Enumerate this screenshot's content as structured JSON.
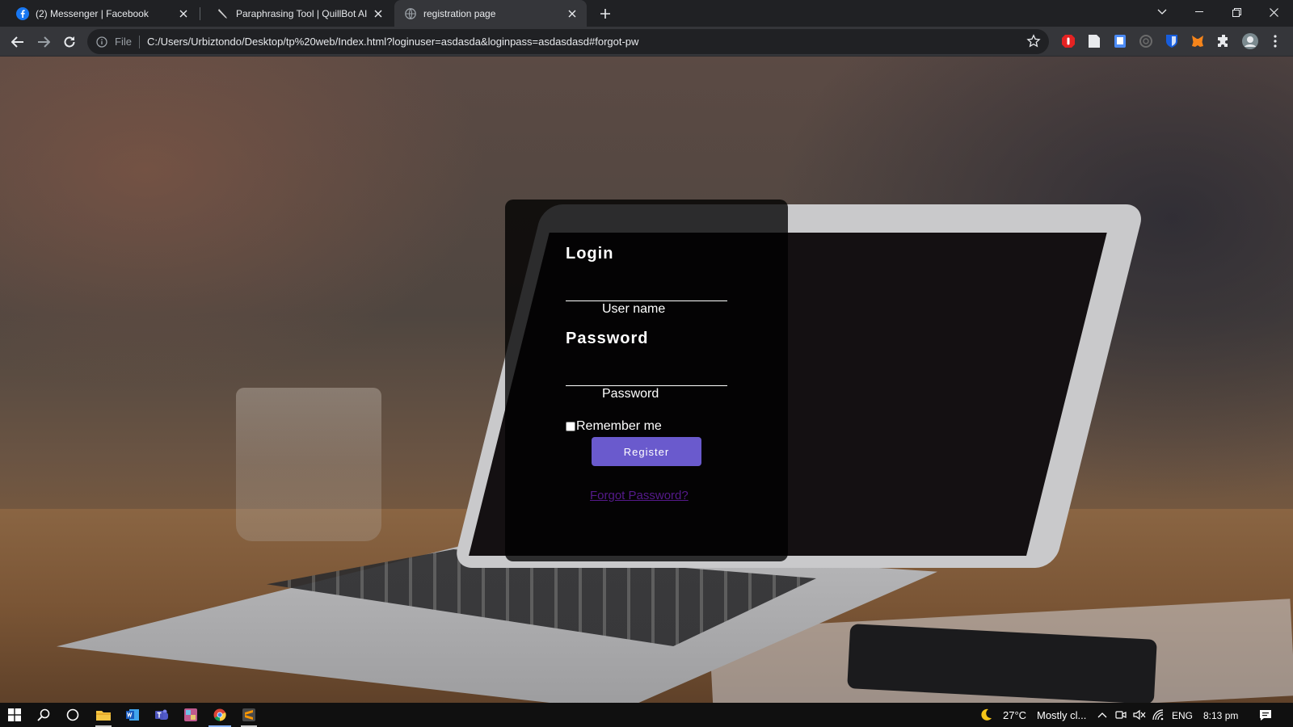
{
  "tabs": [
    {
      "title": "(2) Messenger | Facebook",
      "icon": "facebook-icon"
    },
    {
      "title": "Paraphrasing Tool | QuillBot AI",
      "icon": "quillbot-icon"
    },
    {
      "title": "registration page",
      "icon": "globe-icon"
    }
  ],
  "toolbar": {
    "file_label": "File",
    "url": "C:/Users/Urbiztondo/Desktop/tp%20web/Index.html?loginuser=asdasda&loginpass=asdasdasd#forgot-pw"
  },
  "login_form": {
    "login_heading": "Login",
    "username_label": "User name",
    "password_heading": "Password",
    "password_label": "Password",
    "remember_label": "Remember me",
    "register_label": "Register",
    "forgot_label": "Forgot Password?"
  },
  "taskbar": {
    "weather_temp": "27°C",
    "weather_desc": "Mostly cl...",
    "language": "ENG",
    "time": "8:13 pm"
  },
  "colors": {
    "accent_button": "#6a5acd",
    "link_visited": "#551a8b",
    "browser_dark": "#202124",
    "browser_toolbar": "#35363a"
  }
}
